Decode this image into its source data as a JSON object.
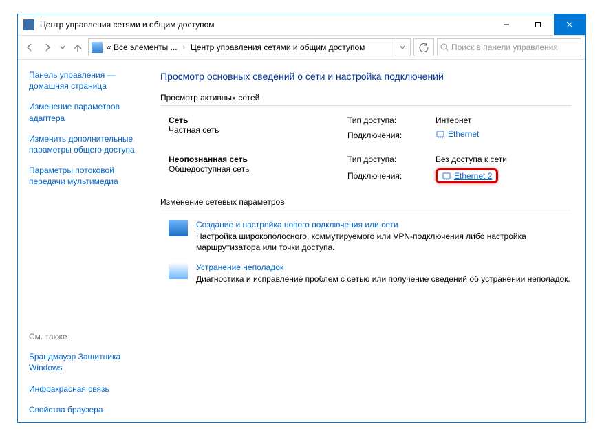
{
  "titlebar": {
    "title": "Центр управления сетями и общим доступом"
  },
  "breadcrumb": {
    "seg1": "« Все элементы ...",
    "seg2": "Центр управления сетями и общим доступом"
  },
  "search": {
    "placeholder": "Поиск в панели управления"
  },
  "sidebar": {
    "home_l1": "Панель управления —",
    "home_l2": "домашняя страница",
    "adapter_l1": "Изменение параметров",
    "adapter_l2": "адаптера",
    "sharing_l1": "Изменить дополнительные",
    "sharing_l2": "параметры общего доступа",
    "stream_l1": "Параметры потоковой",
    "stream_l2": "передачи мультимедиа",
    "seealso": "См. также",
    "firewall_l1": "Брандмауэр Защитника",
    "firewall_l2": "Windows",
    "ir": "Инфракрасная связь",
    "browser": "Свойства браузера"
  },
  "main": {
    "heading": "Просмотр основных сведений о сети и настройка подключений",
    "active_networks": "Просмотр активных сетей",
    "net1": {
      "name": "Сеть",
      "type": "Частная сеть",
      "access_lbl": "Тип доступа:",
      "access_val": "Интернет",
      "conn_lbl": "Подключения:",
      "conn_val": "Ethernet"
    },
    "net2": {
      "name": "Неопознанная сеть",
      "type": "Общедоступная сеть",
      "access_lbl": "Тип доступа:",
      "access_val": "Без доступа к сети",
      "conn_lbl": "Подключения:",
      "conn_val": "Ethernet 2"
    },
    "settings_heading": "Изменение сетевых параметров",
    "task1": {
      "title": "Создание и настройка нового подключения или сети",
      "desc": "Настройка широкополосного, коммутируемого или VPN-подключения либо настройка маршрутизатора или точки доступа."
    },
    "task2": {
      "title": "Устранение неполадок",
      "desc": "Диагностика и исправление проблем с сетью или получение сведений об устранении неполадок."
    }
  }
}
